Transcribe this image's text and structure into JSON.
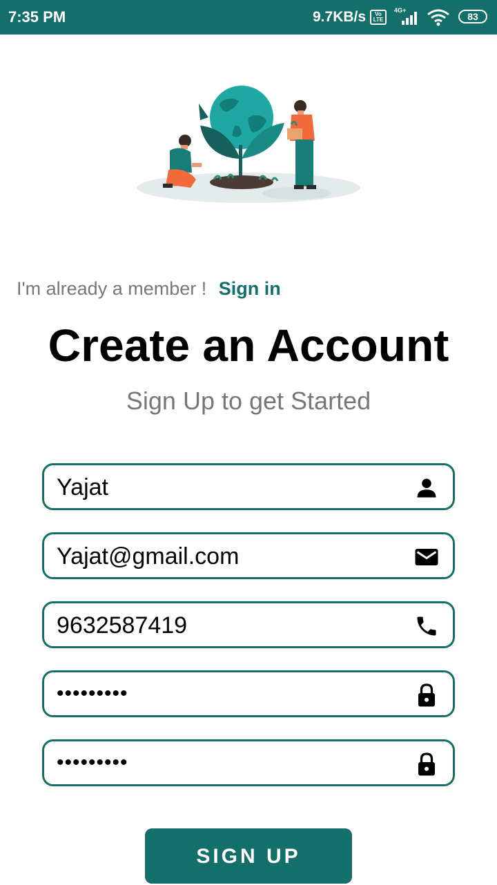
{
  "status_bar": {
    "time": "7:35 PM",
    "net_speed": "9.7KB/s",
    "volte": "Vo LTE",
    "network_type": "4G+",
    "battery": "83"
  },
  "header": {
    "member_text": "I'm already a member !",
    "signin_label": "Sign in",
    "title": "Create an Account",
    "subtitle": "Sign Up to get Started"
  },
  "form": {
    "name": {
      "value": "Yajat",
      "icon": "person-icon"
    },
    "email": {
      "value": "Yajat@gmail.com",
      "icon": "mail-icon"
    },
    "phone": {
      "value": "9632587419",
      "icon": "phone-icon"
    },
    "password": {
      "value": "•••••••••",
      "icon": "lock-icon"
    },
    "confirm_password": {
      "value": "•••••••••",
      "icon": "lock-icon"
    }
  },
  "signup_button": {
    "label": "SIGN UP"
  },
  "colors": {
    "accent": "#146e6a",
    "muted_text": "#777777"
  }
}
